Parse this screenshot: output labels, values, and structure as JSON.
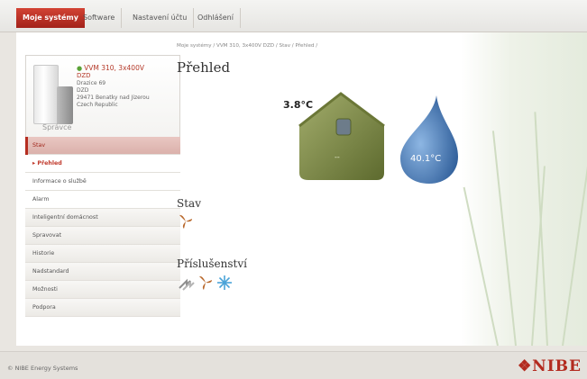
{
  "nav": {
    "tabs": [
      {
        "label": "Moje systémy",
        "active": true
      },
      {
        "label": "Software",
        "active": false
      },
      {
        "label": "Nastavení účtu",
        "active": false
      },
      {
        "label": "Odhlášení",
        "active": false
      }
    ]
  },
  "device": {
    "name": "VVM 310, 3x400V",
    "line1": "DZD",
    "line2": "Drazice 69",
    "line3": "DZD",
    "line4": "29471 Benatky nad Jizerou",
    "line5": "Czech Republic",
    "role": "Správce",
    "status_color": "#5aa236"
  },
  "menu": {
    "items": [
      {
        "label": "Stav"
      },
      {
        "label": "Přehled"
      },
      {
        "label": "Informace o službě"
      },
      {
        "label": "Alarm"
      },
      {
        "label": "Inteligentní domácnost"
      },
      {
        "label": "Spravovat"
      },
      {
        "label": "Historie"
      },
      {
        "label": "Nadstandard"
      },
      {
        "label": "Možnosti"
      },
      {
        "label": "Podpora"
      }
    ]
  },
  "breadcrumb": "Moje systémy / VVM 310, 3x400V DZD / Stav / Přehled /",
  "page_title": "Přehled",
  "overview": {
    "outdoor_temp": "3.8°C",
    "house_label": "--",
    "water_temp": "40.1°C"
  },
  "sections": {
    "status_title": "Stav",
    "accessories_title": "Příslušenství"
  },
  "icons": {
    "status": [
      "fan-icon"
    ],
    "accessories": [
      "heat-exchange-icon",
      "fan-icon",
      "snowflake-icon"
    ]
  },
  "footer": {
    "copyright": "© NIBE Energy Systems",
    "brand": "❖NIBE"
  },
  "colors": {
    "accent": "#b32b1f",
    "house": "#7d8a45",
    "drop": "#3e6ea8",
    "fan": "#b8672a",
    "snow": "#4aa3d8"
  }
}
